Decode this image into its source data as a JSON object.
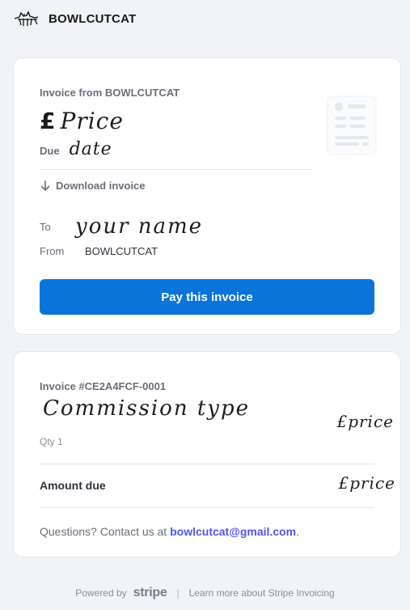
{
  "header": {
    "merchant_name": "BOWLCUTCAT"
  },
  "invoice_card": {
    "invoice_from": "Invoice from BOWLCUTCAT",
    "currency_symbol": "£",
    "price_handwritten": "Price",
    "due_label": "Due",
    "due_handwritten": "date",
    "download_label": "Download invoice",
    "to_label": "To",
    "to_handwritten": "your name",
    "from_label": "From",
    "from_value": "BOWLCUTCAT",
    "pay_button_label": "Pay this invoice"
  },
  "details_card": {
    "invoice_number": "Invoice #CE2A4FCF-0001",
    "item_handwritten": "Commission type",
    "item_price_handwritten": "£price",
    "qty": "Qty 1",
    "amount_due_label": "Amount due",
    "amount_due_handwritten": "£price",
    "questions_prefix": "Questions? Contact us at ",
    "email": "bowlcutcat@gmail.com",
    "questions_suffix": "."
  },
  "footer": {
    "powered_by": "Powered by",
    "stripe": "stripe",
    "separator": "|",
    "learn_more": "Learn more about Stripe Invoicing"
  },
  "colors": {
    "accent": "#0a74da",
    "link": "#4f56e6",
    "background": "#f1f3f7"
  },
  "icons": [
    "cat-logo-icon",
    "invoice-document-icon",
    "download-arrow-icon"
  ]
}
